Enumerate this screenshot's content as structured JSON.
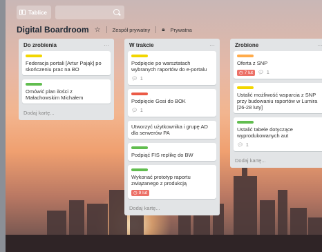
{
  "topbar": {
    "boards_label": "Tablice",
    "search_placeholder": ""
  },
  "board": {
    "title": "Digital Boardroom",
    "team": "Zespół prywatny",
    "visibility": "Prywatna"
  },
  "lists": [
    {
      "title": "Do zrobienia",
      "add_label": "Dodaj kartę...",
      "cards": [
        {
          "label_color": "yellow",
          "text": "Federacja portali [Artur Pająk] po skończeniu prac na BO"
        },
        {
          "label_color": "green",
          "text": "Omówić plan ilości z Małachowskim Michałem"
        }
      ]
    },
    {
      "title": "W trakcie",
      "add_label": "Dodaj kartę...",
      "cards": [
        {
          "label_color": "yellow",
          "text": "Podpięcie po warsztatach wybranych raportów do e-portalu",
          "comments": "1"
        },
        {
          "label_color": "red",
          "text": "Podpięcie Gosi do BOK",
          "comments": "1"
        },
        {
          "label_color": "",
          "text": "Utworzyć użytkownika i grupę AD dla serwerów PA"
        },
        {
          "label_color": "green",
          "text": "Podpiąć FIS replikę do BW"
        },
        {
          "label_color": "green",
          "text": "Wykonać prototyp raportu związanego z produkcją",
          "due": "9 lut"
        }
      ]
    },
    {
      "title": "Zrobione",
      "add_label": "Dodaj kartę...",
      "cards": [
        {
          "label_color": "orange",
          "text": "Oferta z SNP",
          "due": "7 lut",
          "comments": "1"
        },
        {
          "label_color": "yellow",
          "text": "Ustalić możliwość wsparcia z SNP przy budowaniu raportów w Lumira [26-28 luty]"
        },
        {
          "label_color": "green",
          "text": "Ustalić tabele dotyczące wyprodukowanych aut",
          "comments": "1"
        }
      ]
    }
  ],
  "icons": {
    "boards": "boards-icon",
    "search": "search-icon",
    "star": "star-icon",
    "lock": "lock-icon",
    "comment": "comment-icon",
    "clock": "clock-icon"
  },
  "colors": {
    "green": "#61bd4f",
    "yellow": "#f2d600",
    "orange": "#ffab4a",
    "red": "#eb5a46",
    "due": "#ec7168"
  }
}
